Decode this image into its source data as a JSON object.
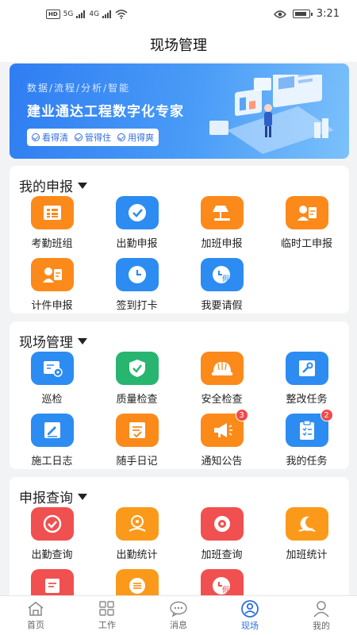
{
  "statusbar": {
    "network": "HD",
    "sig1": "5G",
    "sig2": "4G",
    "time": "3:21"
  },
  "header": {
    "title": "现场管理"
  },
  "banner": {
    "tagline": "数据/流程/分析/智能",
    "title": "建业通达工程数字化专家",
    "pills": [
      "看得清",
      "管得住",
      "用得爽"
    ]
  },
  "sections": [
    {
      "title": "我的申报",
      "items": [
        {
          "label": "考勤班组",
          "color": "#fb8a1a",
          "icon": "attendance-team-icon"
        },
        {
          "label": "出勤申报",
          "color": "#2c8cf2",
          "icon": "checkmark-icon"
        },
        {
          "label": "加班申报",
          "color": "#fb8a1a",
          "icon": "desk-lamp-icon"
        },
        {
          "label": "临时工申报",
          "color": "#fb8a1a",
          "icon": "id-card-icon"
        },
        {
          "label": "计件申报",
          "color": "#fb8a1a",
          "icon": "id-card-icon"
        },
        {
          "label": "签到打卡",
          "color": "#2c8cf2",
          "icon": "clock-icon"
        },
        {
          "label": "我要请假",
          "color": "#2c8cf2",
          "icon": "leave-clock-icon"
        }
      ]
    },
    {
      "title": "现场管理",
      "items": [
        {
          "label": "巡检",
          "color": "#2c8cf2",
          "icon": "inspection-eye-icon"
        },
        {
          "label": "质量检查",
          "color": "#27b56f",
          "icon": "shield-check-icon"
        },
        {
          "label": "安全检查",
          "color": "#fb8a1a",
          "icon": "helmet-icon"
        },
        {
          "label": "整改任务",
          "color": "#2c8cf2",
          "icon": "wrench-icon"
        },
        {
          "label": "施工日志",
          "color": "#2c8cf2",
          "icon": "log-edit-icon"
        },
        {
          "label": "随手日记",
          "color": "#fb8a1a",
          "icon": "diary-icon"
        },
        {
          "label": "通知公告",
          "color": "#fb8a1a",
          "icon": "megaphone-icon",
          "badge": "3"
        },
        {
          "label": "我的任务",
          "color": "#2c8cf2",
          "icon": "clipboard-icon",
          "badge": "2"
        }
      ]
    },
    {
      "title": "申报查询",
      "items": [
        {
          "label": "出勤查询",
          "color": "#f0504f",
          "icon": "checkmark-icon"
        },
        {
          "label": "出勤统计",
          "color": "#fb9a1a",
          "icon": "stats-person-icon"
        },
        {
          "label": "加班查询",
          "color": "#f0504f",
          "icon": "eye-icon"
        },
        {
          "label": "加班统计",
          "color": "#fb9a1a",
          "icon": "moon-icon"
        },
        {
          "label": "",
          "color": "#f0504f",
          "icon": "id-card-icon"
        },
        {
          "label": "",
          "color": "#fb9a1a",
          "icon": "list-icon"
        },
        {
          "label": "",
          "color": "#f0504f",
          "icon": "leave-clock-icon"
        }
      ]
    }
  ],
  "tabbar": [
    {
      "label": "首页",
      "icon": "home-icon"
    },
    {
      "label": "工作",
      "icon": "grid-icon"
    },
    {
      "label": "消息",
      "icon": "message-icon"
    },
    {
      "label": "现场",
      "icon": "site-person-icon",
      "active": true
    },
    {
      "label": "我的",
      "icon": "user-icon"
    }
  ]
}
